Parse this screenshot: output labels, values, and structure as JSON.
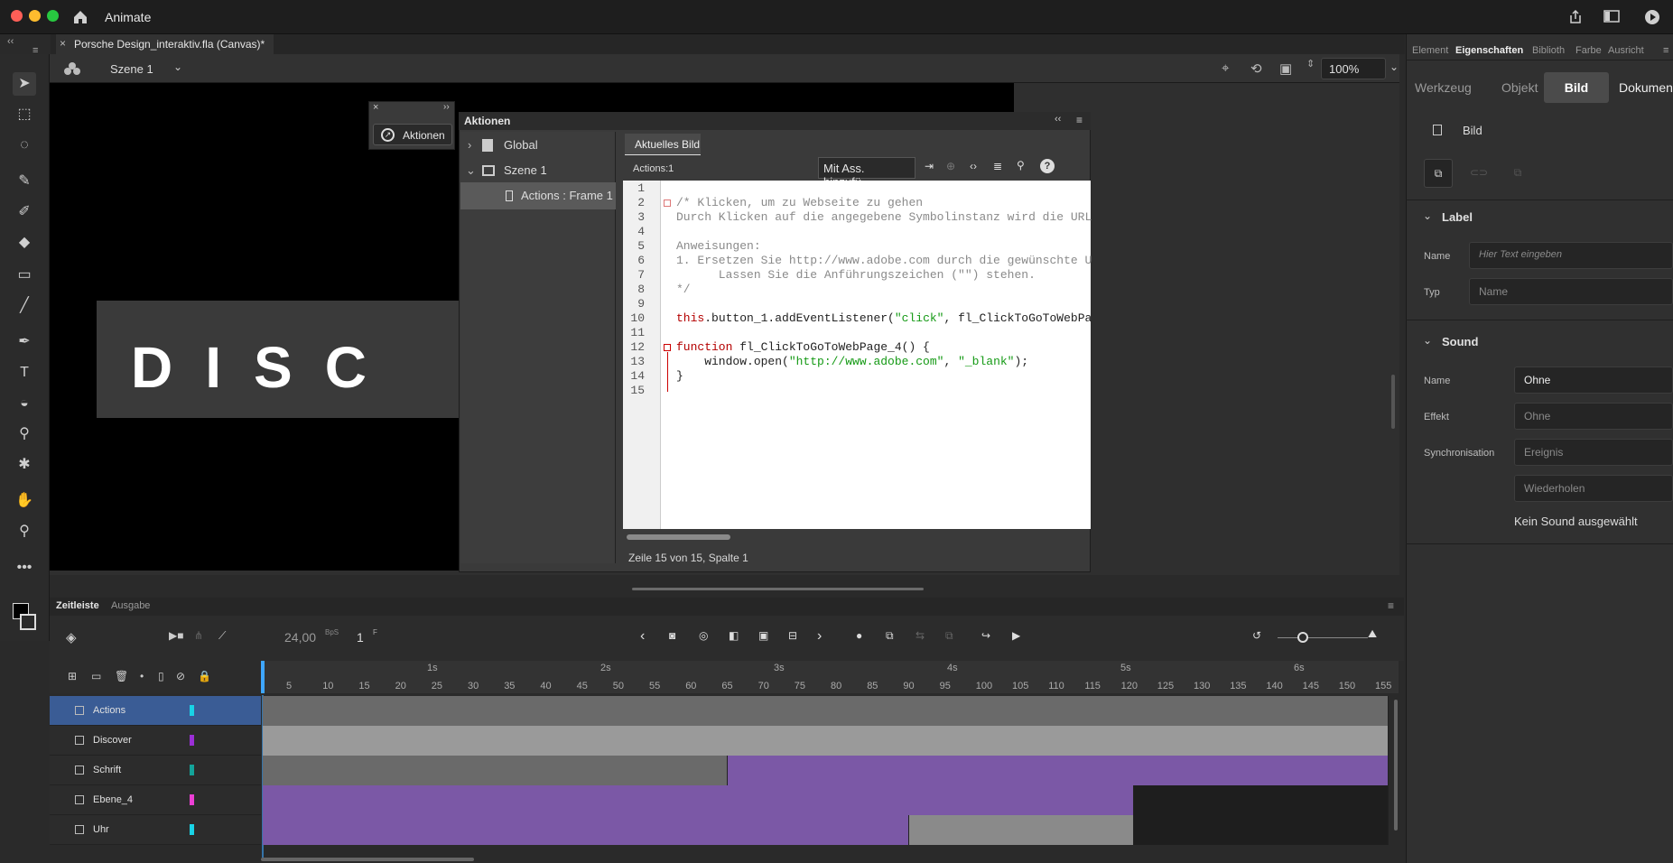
{
  "app": {
    "name": "Animate"
  },
  "document": {
    "tab_title": "Porsche Design_interaktiv.fla (Canvas)*"
  },
  "stage_header": {
    "scene": "Szene 1",
    "zoom": "100%"
  },
  "stage": {
    "banner_text": "DISC"
  },
  "mini_panel": {
    "button_label": "Aktionen"
  },
  "actions_panel": {
    "title": "Aktionen",
    "tree": {
      "global": "Global",
      "scene": "Szene 1",
      "frame": "Actions : Frame 1"
    },
    "tab": "Aktuelles Bild",
    "location": "Actions:1",
    "assist_button": "Mit Ass. hinzufü...",
    "line_numbers": [
      "1",
      "2",
      "3",
      "4",
      "5",
      "6",
      "7",
      "8",
      "9",
      "10",
      "11",
      "12",
      "13",
      "14",
      "15"
    ],
    "code": {
      "l2": "/* Klicken, um zu Webseite zu gehen",
      "l3": "Durch Klicken auf die angegebene Symbolinstanz wird die URL",
      "l5": "Anweisungen:",
      "l6": "1. Ersetzen Sie http://www.adobe.com durch die gewünschte U",
      "l7": "      Lassen Sie die Anführungszeichen (\"\") stehen.",
      "l8": "*/",
      "l10a": "this",
      "l10b": ".button_1.addEventListener(",
      "l10c": "\"click\"",
      "l10d": ", fl_ClickToGoToWebPa",
      "l12a": "function",
      "l12b": " fl_ClickToGoToWebPage_4() {",
      "l13a": "    window.open(",
      "l13b": "\"http://www.adobe.com\"",
      "l13c": ", ",
      "l13d": "\"_blank\"",
      "l13e": ");",
      "l14": "}"
    },
    "status": "Zeile 15 von 15, Spalte 1"
  },
  "right_panel": {
    "tabs": [
      "Element",
      "Eigenschaften",
      "Biblioth",
      "Farbe",
      "Ausricht"
    ],
    "segments": [
      "Werkzeug",
      "Objekt",
      "Bild",
      "Dokument"
    ],
    "frame_label": "Bild",
    "label_section": "Label",
    "name_label": "Name",
    "name_placeholder": "Hier Text eingeben",
    "typ_label": "Typ",
    "typ_value": "Name",
    "sound_section": "Sound",
    "sound_name_label": "Name",
    "sound_name_value": "Ohne",
    "effect_label": "Effekt",
    "effect_value": "Ohne",
    "sync_label": "Synchronisation",
    "sync_value": "Ereignis",
    "repeat_value": "Wiederholen",
    "no_sound": "Kein Sound ausgewählt"
  },
  "timeline": {
    "tabs": [
      "Zeitleiste",
      "Ausgabe"
    ],
    "fps": "24,00",
    "fps_unit": "BpS",
    "frame": "1",
    "frame_unit": "F",
    "ruler_labels": [
      "5",
      "10",
      "15",
      "20",
      "25",
      "30",
      "35",
      "40",
      "45",
      "50",
      "55",
      "60",
      "65",
      "70",
      "75",
      "80",
      "85",
      "90",
      "95",
      "100",
      "105",
      "110",
      "115",
      "120",
      "125",
      "130",
      "135",
      "140",
      "145",
      "150",
      "155"
    ],
    "second_labels": [
      "1s",
      "2s",
      "3s",
      "4s",
      "5s",
      "6s"
    ],
    "layers": [
      {
        "name": "Actions",
        "color": "#19d3e6"
      },
      {
        "name": "Discover",
        "color": "#9b2fd6"
      },
      {
        "name": "Schrift",
        "color": "#14a39a"
      },
      {
        "name": "Ebene_4",
        "color": "#ec3fd4"
      },
      {
        "name": "Uhr",
        "color": "#19d3e6"
      }
    ]
  },
  "colors": {
    "accent": "#3a5c95",
    "tween": "#7b58a6",
    "static": "#6a6a6a"
  }
}
